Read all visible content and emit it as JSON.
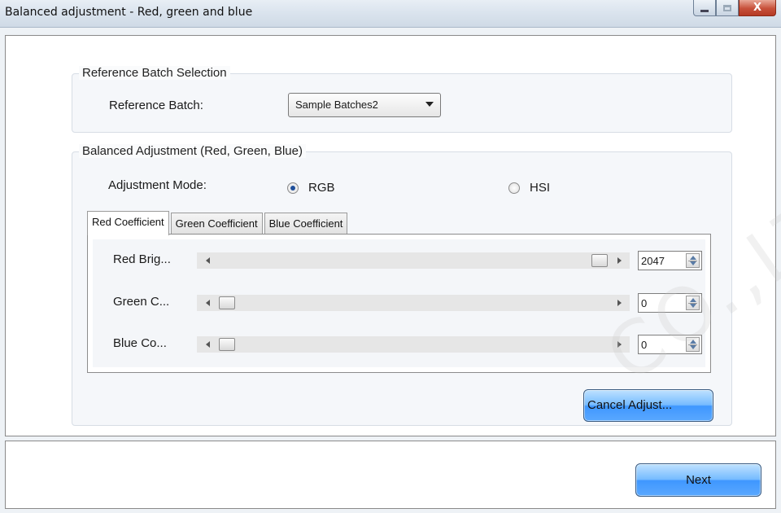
{
  "window": {
    "title": "Balanced adjustment - Red, green and blue",
    "controls": {
      "minimize_icon": "minimize-icon",
      "maximize_icon": "maximize-icon",
      "close_label": "X"
    }
  },
  "reference_group": {
    "title": "Reference Batch Selection",
    "batch_label": "Reference Batch:",
    "batch_value": "Sample Batches2"
  },
  "balance_group": {
    "title": "Balanced Adjustment (Red, Green, Blue)",
    "mode_label": "Adjustment Mode:",
    "modes": [
      {
        "label": "RGB",
        "checked": true
      },
      {
        "label": "HSI",
        "checked": false
      }
    ],
    "tabs": [
      {
        "label": "Red Coefficient",
        "active": true
      },
      {
        "label": "Green Coefficient",
        "active": false
      },
      {
        "label": "Blue Coefficient",
        "active": false
      }
    ],
    "sliders": [
      {
        "label": "Red Brig...",
        "value": "2047",
        "level": 1.0
      },
      {
        "label": "Green C...",
        "value": "0",
        "level": 0.0
      },
      {
        "label": "Blue Co...",
        "value": "0",
        "level": 0.0
      }
    ],
    "cancel_label": "Cancel Adjust..."
  },
  "footer": {
    "next_label": "Next"
  },
  "watermark": "CO.,LT"
}
